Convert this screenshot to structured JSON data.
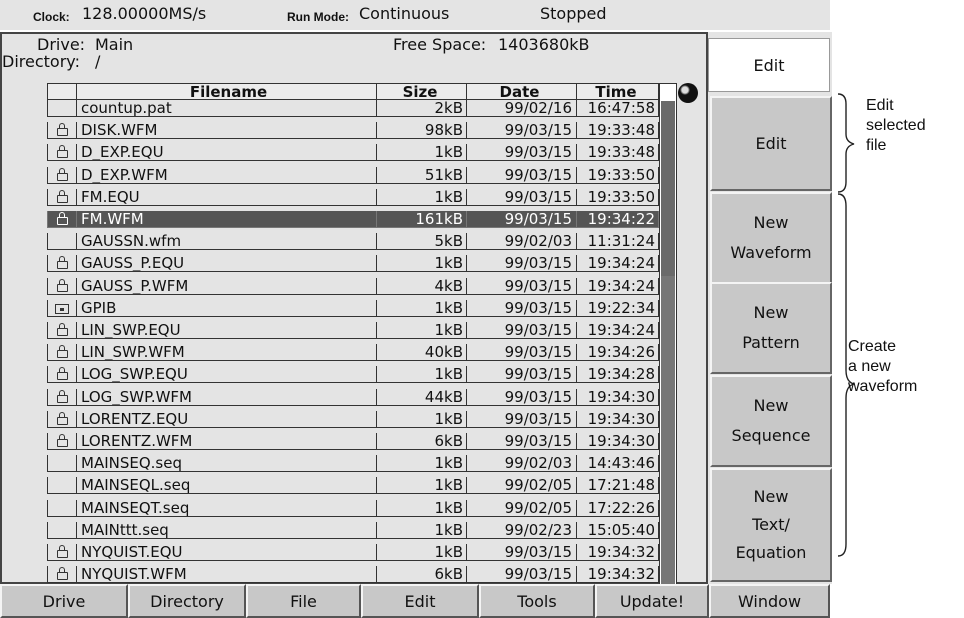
{
  "status": {
    "clock_label": "Clock:",
    "clock_value": "128.00000MS/s",
    "runmode_label": "Run Mode:",
    "runmode_value": "Continuous",
    "state": "Stopped"
  },
  "panel": {
    "drive_label": "Drive:",
    "drive_value": "Main",
    "directory_label": "Directory:",
    "directory_value": "/",
    "freespace_label": "Free Space:",
    "freespace_value": "1403680kB"
  },
  "table": {
    "headers": {
      "filename": "Filename",
      "size": "Size",
      "date": "Date",
      "time": "Time"
    },
    "rows": [
      {
        "icon": "none",
        "name": "countup.pat",
        "size": "2kB",
        "date": "99/02/16",
        "time": "16:47:58"
      },
      {
        "icon": "lock",
        "name": "DISK.WFM",
        "size": "98kB",
        "date": "99/03/15",
        "time": "19:33:48"
      },
      {
        "icon": "lock",
        "name": "D_EXP.EQU",
        "size": "1kB",
        "date": "99/03/15",
        "time": "19:33:48"
      },
      {
        "icon": "lock",
        "name": "D_EXP.WFM",
        "size": "51kB",
        "date": "99/03/15",
        "time": "19:33:50"
      },
      {
        "icon": "lock",
        "name": "FM.EQU",
        "size": "1kB",
        "date": "99/03/15",
        "time": "19:33:50"
      },
      {
        "icon": "lock",
        "name": "FM.WFM",
        "size": "161kB",
        "date": "99/03/15",
        "time": "19:34:22",
        "selected": true
      },
      {
        "icon": "none",
        "name": "GAUSSN.wfm",
        "size": "5kB",
        "date": "99/02/03",
        "time": "11:31:24"
      },
      {
        "icon": "lock",
        "name": "GAUSS_P.EQU",
        "size": "1kB",
        "date": "99/03/15",
        "time": "19:34:24"
      },
      {
        "icon": "lock",
        "name": "GAUSS_P.WFM",
        "size": "4kB",
        "date": "99/03/15",
        "time": "19:34:24"
      },
      {
        "icon": "folder",
        "name": "GPIB",
        "size": "1kB",
        "date": "99/03/15",
        "time": "19:22:34"
      },
      {
        "icon": "lock",
        "name": "LIN_SWP.EQU",
        "size": "1kB",
        "date": "99/03/15",
        "time": "19:34:24"
      },
      {
        "icon": "lock",
        "name": "LIN_SWP.WFM",
        "size": "40kB",
        "date": "99/03/15",
        "time": "19:34:26"
      },
      {
        "icon": "lock",
        "name": "LOG_SWP.EQU",
        "size": "1kB",
        "date": "99/03/15",
        "time": "19:34:28"
      },
      {
        "icon": "lock",
        "name": "LOG_SWP.WFM",
        "size": "44kB",
        "date": "99/03/15",
        "time": "19:34:30"
      },
      {
        "icon": "lock",
        "name": "LORENTZ.EQU",
        "size": "1kB",
        "date": "99/03/15",
        "time": "19:34:30"
      },
      {
        "icon": "lock",
        "name": "LORENTZ.WFM",
        "size": "6kB",
        "date": "99/03/15",
        "time": "19:34:30"
      },
      {
        "icon": "none",
        "name": "MAINSEQ.seq",
        "size": "1kB",
        "date": "99/02/03",
        "time": "14:43:46"
      },
      {
        "icon": "none",
        "name": "MAINSEQL.seq",
        "size": "1kB",
        "date": "99/02/05",
        "time": "17:21:48"
      },
      {
        "icon": "none",
        "name": "MAINSEQT.seq",
        "size": "1kB",
        "date": "99/02/05",
        "time": "17:22:26"
      },
      {
        "icon": "none",
        "name": "MAINttt.seq",
        "size": "1kB",
        "date": "99/02/23",
        "time": "15:05:40"
      },
      {
        "icon": "lock",
        "name": "NYQUIST.EQU",
        "size": "1kB",
        "date": "99/03/15",
        "time": "19:34:32"
      },
      {
        "icon": "lock",
        "name": "NYQUIST.WFM",
        "size": "6kB",
        "date": "99/03/15",
        "time": "19:34:32"
      }
    ]
  },
  "side": {
    "title": "Edit",
    "edit": "Edit",
    "new_waveform": [
      "New",
      "Waveform"
    ],
    "new_pattern": [
      "New",
      "Pattern"
    ],
    "new_sequence": [
      "New",
      "Sequence"
    ],
    "new_text_equation": [
      "New",
      "Text/",
      "Equation"
    ]
  },
  "bottom": [
    "Drive",
    "Directory",
    "File",
    "Edit",
    "Tools",
    "Update!",
    "Window"
  ],
  "annotations": {
    "edit_selected": [
      "Edit",
      "selected",
      "file"
    ],
    "create_new": [
      "Create",
      "a new",
      "waveform"
    ]
  }
}
